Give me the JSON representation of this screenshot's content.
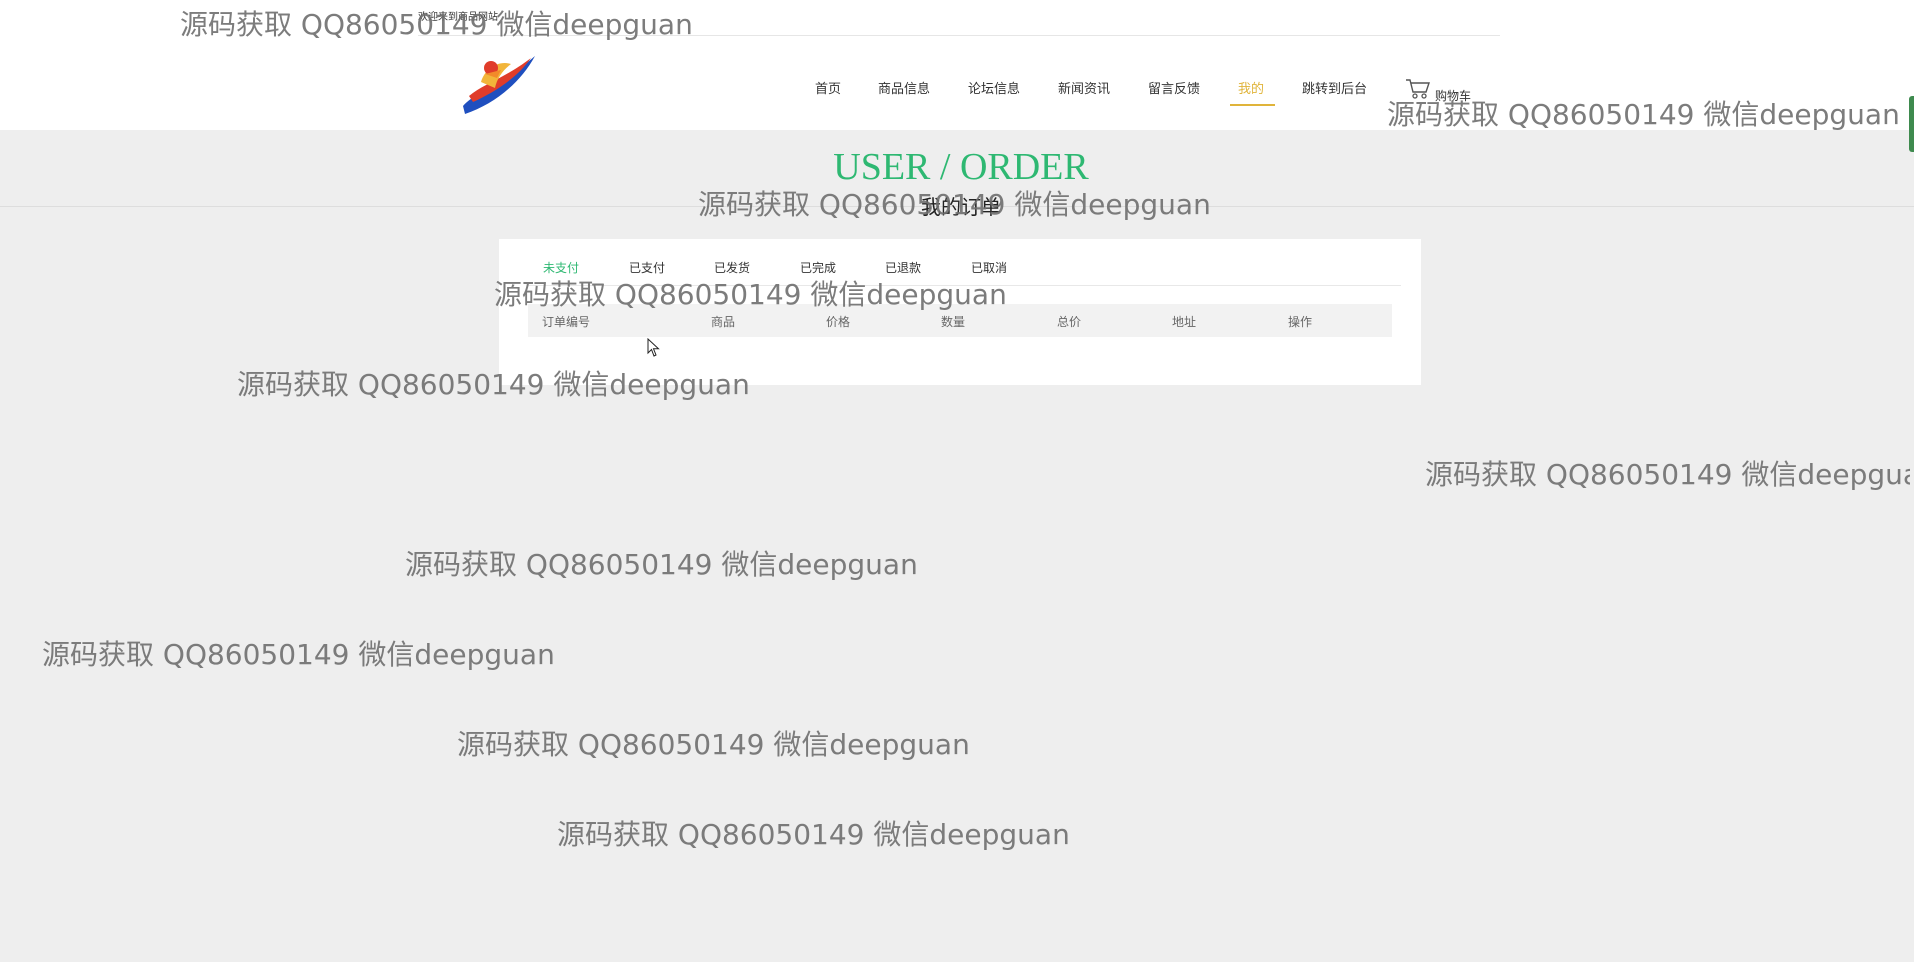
{
  "topbar": {
    "text": "欢迎来到商品网站"
  },
  "nav": {
    "items": [
      "首页",
      "商品信息",
      "论坛信息",
      "新闻资讯",
      "留言反馈",
      "我的",
      "跳转到后台"
    ],
    "active_index": 5,
    "cart_label": "购物车"
  },
  "page": {
    "title_en": "USER / ORDER",
    "title_cn": "我的订单"
  },
  "order_tabs": {
    "items": [
      "未支付",
      "已支付",
      "已发货",
      "已完成",
      "已退款",
      "已取消"
    ],
    "active_index": 0
  },
  "table": {
    "headers": [
      "订单编号",
      "商品",
      "价格",
      "数量",
      "总价",
      "地址",
      "操作"
    ],
    "rows": []
  },
  "watermark": "源码获取 QQ86050149 微信deepguan",
  "colors": {
    "accent_green": "#2eb872",
    "nav_active": "#e0b43a",
    "background": "#eeeeee"
  }
}
